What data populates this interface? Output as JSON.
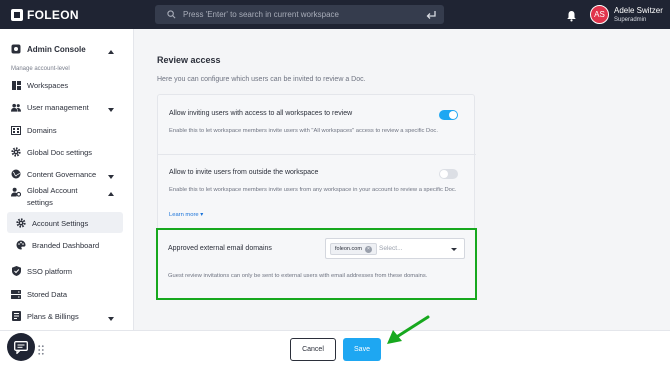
{
  "brand": {
    "name": "FOLEON",
    "accent": "#1ea7f2",
    "highlight": "#17a81e"
  },
  "search": {
    "placeholder": "Press 'Enter' to search in current workspace"
  },
  "user": {
    "initials": "AS",
    "name": "Adele Switzer",
    "role": "Superadmin"
  },
  "sidebar": {
    "header": "Admin Console",
    "subheader": "Manage account-level",
    "items": [
      {
        "label": "Workspaces",
        "icon": "workspaces-icon"
      },
      {
        "label": "User management",
        "icon": "users-icon"
      },
      {
        "label": "Domains",
        "icon": "domains-icon"
      },
      {
        "label": "Global Doc settings",
        "icon": "gear-icon"
      },
      {
        "label": "Content Governance",
        "icon": "globe-icon"
      },
      {
        "label": "Global Account",
        "label2": "settings",
        "icon": "account-settings-icon"
      },
      {
        "label": "Account Settings",
        "icon": "gear-icon"
      },
      {
        "label": "Branded Dashboard",
        "icon": "palette-icon"
      },
      {
        "label": "SSO platform",
        "icon": "shield-icon"
      },
      {
        "label": "Stored Data",
        "icon": "storage-icon"
      },
      {
        "label": "Plans & Billings",
        "icon": "billing-icon"
      }
    ]
  },
  "review": {
    "title": "Review access",
    "intro": "Here you can configure which users can be invited to review a Doc.",
    "option1": {
      "title": "Allow inviting users with access to all workspaces to review",
      "desc": "Enable this to let workspace members invite users with \"All workspaces\" access to review a specific Doc.",
      "enabled": true
    },
    "option2": {
      "title": "Allow to invite users from outside the workspace",
      "desc": "Enable this to let workspace members invite users from any workspace in your account to review a specific Doc.",
      "enabled": false,
      "learn_more": "Learn more"
    },
    "approved": {
      "label": "Approved external email domains",
      "chip": "foleon.com",
      "placeholder": "Select...",
      "desc": "Guest review invitations can only be sent to external users with email addresses from these domains."
    }
  },
  "footer": {
    "cancel": "Cancel",
    "save": "Save"
  }
}
